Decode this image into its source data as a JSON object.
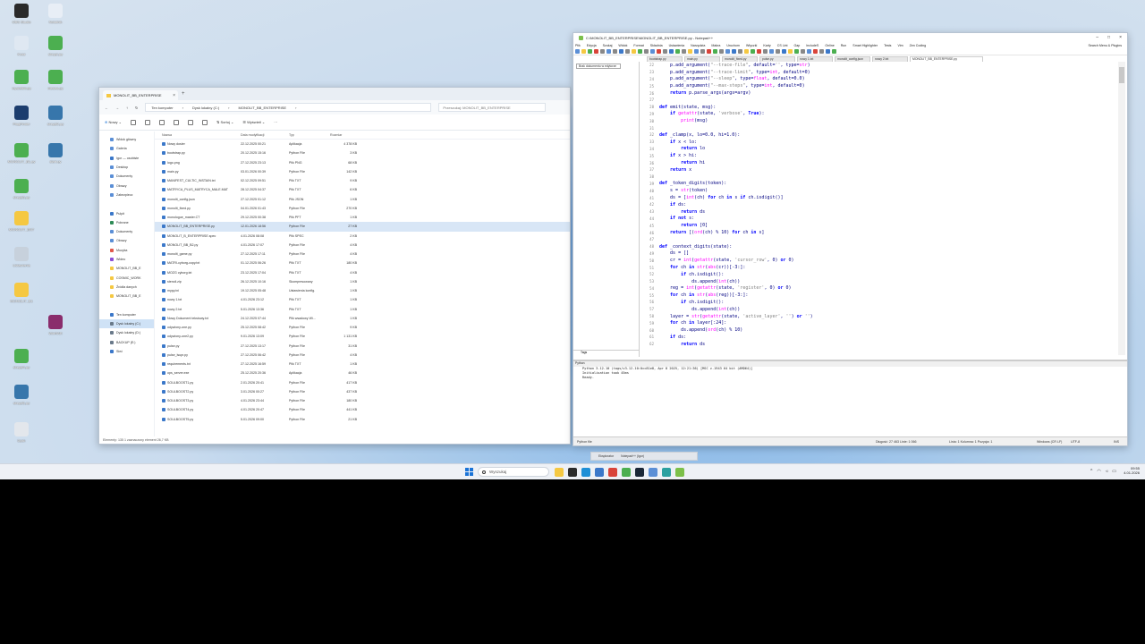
{
  "desktop": {
    "icons": [
      {
        "label": "OBS Studio",
        "color": "#2a2a2a"
      },
      {
        "label": "Notatnik",
        "color": "#e8eef6"
      },
      {
        "label": "Kosz",
        "color": "#dfe8f2"
      },
      {
        "label": "skrypt.py",
        "color": "#4caf50"
      },
      {
        "label": "mycielski.py",
        "color": "#4caf50"
      },
      {
        "label": "meseo.py",
        "color": "#4caf50"
      },
      {
        "label": "FlagFinder",
        "color": "#1c3d6e"
      },
      {
        "label": "skrypt2.py",
        "color": "#3776ab"
      },
      {
        "label": "MONOLIT_B1.py",
        "color": "#4caf50"
      },
      {
        "label": "start.py",
        "color": "#3776ab"
      },
      {
        "label": "skrypt3.py",
        "color": "#4caf50"
      },
      {
        "label": "MONOLIT_ENT",
        "color": "#f5c842"
      },
      {
        "label": "Ustawienia",
        "color": "#c7d1dc"
      },
      {
        "label": "MONOLIT_B1",
        "color": "#f5c842"
      },
      {
        "label": "WinRAR",
        "color": "#8a2d6c"
      },
      {
        "label": "skrypt4.py",
        "color": "#4caf50"
      },
      {
        "label": "skrypt5.py",
        "color": "#3776ab"
      },
      {
        "label": "Dysk",
        "color": "#e3e7ec"
      }
    ]
  },
  "explorer": {
    "tab_title": "MONOLIT_BB_ENTERPRISE",
    "crumbs": [
      "Ten komputer",
      "Dysk lokalny (C:)",
      "MONOLIT_BB_ENTERPRISE"
    ],
    "search_placeholder": "Przeszukaj: MONOLIT_BB_ENTERPRISE",
    "toolbar_new": "Nowy",
    "toolbar_sort": "Sortuj",
    "toolbar_view": "Wyświetl",
    "nav": [
      {
        "label": "Widok główny",
        "color": "#5b8fd6"
      },
      {
        "label": "Galeria",
        "color": "#5b8fd6"
      },
      {
        "label": "Igor — osobiste",
        "color": "#3b78c9"
      },
      {
        "label": "Desktop",
        "color": "#5b8fd6"
      },
      {
        "label": "Dokumenty",
        "color": "#5b8fd6"
      },
      {
        "label": "Obrazy",
        "color": "#5b8fd6"
      },
      {
        "label": "Zabezpiecz",
        "color": "#5b8fd6"
      },
      {
        "label": "",
        "color": "transparent"
      },
      {
        "label": "Pulpit",
        "color": "#3b78c9"
      },
      {
        "label": "Pobrane",
        "color": "#2e8b57"
      },
      {
        "label": "Dokumenty",
        "color": "#5b8fd6"
      },
      {
        "label": "Obrazy",
        "color": "#5b8fd6"
      },
      {
        "label": "Muzyka",
        "color": "#e0584b"
      },
      {
        "label": "Wideo",
        "color": "#8a4fd6"
      },
      {
        "label": "MONOLIT_BB_E",
        "color": "#f5c842"
      },
      {
        "label": "COSMIC_WORK",
        "color": "#f5c842"
      },
      {
        "label": "Źródła danych",
        "color": "#f5c842"
      },
      {
        "label": "MONOLIT_BB_E",
        "color": "#f5c842"
      },
      {
        "label": "",
        "color": "transparent"
      },
      {
        "label": "Ten komputer",
        "color": "#3b78c9"
      },
      {
        "label": "Dysk lokalny (C:)",
        "color": "#6a7a8a"
      },
      {
        "label": "Dysk lokalny (D:)",
        "color": "#6a7a8a"
      },
      {
        "label": "BACKUP (E:)",
        "color": "#6a7a8a"
      },
      {
        "label": "Sieć",
        "color": "#3b78c9"
      }
    ],
    "columns": [
      "Nazwa",
      "Data modyfikacji",
      "Typ",
      "Rozmiar"
    ],
    "files": [
      {
        "name": "Nowy dosier",
        "date": "22.12.2025 00:21",
        "type": "Aplikacja",
        "size": "4 378 KB"
      },
      {
        "name": "bootstrap.py",
        "date": "20.12.2025 15:16",
        "type": "Python File",
        "size": "3 KB"
      },
      {
        "name": "logo.png",
        "date": "27.12.2025 23:13",
        "type": "Plik PNG",
        "size": "68 KB"
      },
      {
        "name": "main.py",
        "date": "03.01.2026 00:39",
        "type": "Python File",
        "size": "142 KB"
      },
      {
        "name": "MANIFEST_CULTIC_INSTAIN.txt",
        "date": "02.12.2025 09:51",
        "type": "Plik TXT",
        "size": "9 KB"
      },
      {
        "name": "MATRYCA_PLUS_MATRYCA_MALE.MAT",
        "date": "28.12.2025 04:37",
        "type": "Plik TXT",
        "size": "6 KB"
      },
      {
        "name": "monolit_config.json",
        "date": "27.12.2025 01:12",
        "type": "Plik JSON",
        "size": "1 KB"
      },
      {
        "name": "monolit_fixed.py",
        "date": "04.01.2026 01:43",
        "type": "Python File",
        "size": "270 KB"
      },
      {
        "name": "monologue_master.CT",
        "date": "29.12.2025 00:38",
        "type": "Plik PFT",
        "size": "1 KB"
      },
      {
        "name": "MONOLIT_BB_ENTERPRISE.py",
        "date": "12.01.2026 18:56",
        "type": "Python File",
        "size": "27 KB"
      },
      {
        "name": "MONOLIT_B_ENTERPRISE.spec",
        "date": "4.01.2026 08:08",
        "type": "Plik SPEC",
        "size": "2 KB"
      },
      {
        "name": "MONOLIT_BB_B2.py",
        "date": "4.01.2026 17:07",
        "type": "Python File",
        "size": "4 KB"
      },
      {
        "name": "monolit_game.py",
        "date": "27.12.2025 17:11",
        "type": "Python File",
        "size": "4 KB"
      },
      {
        "name": "MATRI-cyborg-copy.txt",
        "date": "01.12.2025 06:26",
        "type": "Plik TXT",
        "size": "180 KB"
      },
      {
        "name": "MOZG cyborg.txt",
        "date": "23.12.2025 17:04",
        "type": "Plik TXT",
        "size": "4 KB"
      },
      {
        "name": "stencil.zip",
        "date": "26.12.2025 10:16",
        "type": "Skompresowany",
        "size": "1 KB"
      },
      {
        "name": "mypy.ini",
        "date": "19.12.2025 05:48",
        "type": "Ustawienia konfig.",
        "size": "1 KB"
      },
      {
        "name": "nowy 1.txt",
        "date": "4.01.2026 23:12",
        "type": "Plik TXT",
        "size": "1 KB"
      },
      {
        "name": "nowy 2.txt",
        "date": "5.01.2026 13:36",
        "type": "Plik TXT",
        "size": "1 KB"
      },
      {
        "name": "Nowy Dokument tekstowy.txt",
        "date": "24.12.2025 07:44",
        "type": "Plik wsadowy Wi...",
        "size": "1 KB"
      },
      {
        "name": "odywiony-one.py",
        "date": "25.12.2025 08:42",
        "type": "Python File",
        "size": "9 KB"
      },
      {
        "name": "odywiony-one2.py",
        "date": "9.01.2026 13:09",
        "type": "Python File",
        "size": "1 131 KB"
      },
      {
        "name": "pulse.py",
        "date": "27.12.2025 13:17",
        "type": "Python File",
        "size": "31 KB"
      },
      {
        "name": "pulse_lsupr.py",
        "date": "27.12.2025 06:42",
        "type": "Python File",
        "size": "4 KB"
      },
      {
        "name": "requirements.txt",
        "date": "27.12.2025 16:59",
        "type": "Plik TXT",
        "size": "1 KB"
      },
      {
        "name": "ops_server.exe",
        "date": "25.12.2025 20:36",
        "type": "Aplikacja",
        "size": "46 KB"
      },
      {
        "name": "SOULBOOST1.py",
        "date": "2.01.2026 20:41",
        "type": "Python File",
        "size": "417 KB"
      },
      {
        "name": "SOULBOOST2.py",
        "date": "3.01.2026 00:27",
        "type": "Python File",
        "size": "437 KB"
      },
      {
        "name": "SOULBOOST3.py",
        "date": "4.01.2026 23:44",
        "type": "Python File",
        "size": "180 KB"
      },
      {
        "name": "SOULBOOST4.py",
        "date": "4.01.2026 20:47",
        "type": "Python File",
        "size": "441 KB"
      },
      {
        "name": "SOULBOOST5.py",
        "date": "5.01.2026 09:00",
        "type": "Python File",
        "size": "21 KB"
      }
    ],
    "status": "Elementy: 135    1 zaznaczony element  26,7 KB"
  },
  "npp": {
    "title": "C:\\MONOLIT_BB_ENTERPRISE\\MONOLIT_BB_ENTERPRISE.py - Notepad++",
    "menu": [
      "Plik",
      "Edycja",
      "Szukaj",
      "Widok",
      "Format",
      "Składnia",
      "Ustawienia",
      "Narzędzia",
      "Makra",
      "Uruchom",
      "Wtyczki",
      "Karty",
      "CS Lint",
      "Gap",
      "IncludeS",
      "Online",
      "Run",
      "Smart Highlighter",
      "Tests",
      "Vim",
      "Zen Coding"
    ],
    "search_hint": "Search Menu & Plugins",
    "tabs": [
      "bootstrap.py",
      "main.py",
      "monolit_fixed.py",
      "pulse.py",
      "nowy 1.txt",
      "monolit_config.json",
      "nowy 2.txt",
      "MONOLIT_BB_ENTERPRISE.py"
    ],
    "left_panel_label": "Brak dokumentu w edytorze",
    "left_footer": "Tags",
    "code_lines": [
      {
        "n": "22",
        "t": "    p.add_argument(\"--trace-file\", default='', type=str)"
      },
      {
        "n": "23",
        "t": "    p.add_argument(\"--trace-limit\", type=int, default=0)"
      },
      {
        "n": "24",
        "t": "    p.add_argument(\"--sleep\", type=float, default=0.0)"
      },
      {
        "n": "25",
        "t": "    p.add_argument(\"--max-steps\", type=int, default=0)"
      },
      {
        "n": "26",
        "t": "    return p.parse_args(args=argv)"
      },
      {
        "n": "27",
        "t": ""
      },
      {
        "n": "28",
        "t": "def emit(state, msg):"
      },
      {
        "n": "29",
        "t": "    if getattr(state, 'verbose', True):"
      },
      {
        "n": "30",
        "t": "        print(msg)"
      },
      {
        "n": "31",
        "t": ""
      },
      {
        "n": "32",
        "t": "def _clamp(x, lo=0.0, hi=1.0):"
      },
      {
        "n": "33",
        "t": "    if x < lo:"
      },
      {
        "n": "34",
        "t": "        return lo"
      },
      {
        "n": "35",
        "t": "    if x > hi:"
      },
      {
        "n": "36",
        "t": "        return hi"
      },
      {
        "n": "37",
        "t": "    return x"
      },
      {
        "n": "38",
        "t": ""
      },
      {
        "n": "39",
        "t": "def _token_digits(token):"
      },
      {
        "n": "40",
        "t": "    s = str(token)"
      },
      {
        "n": "41",
        "t": "    ds = [int(ch) for ch in s if ch.isdigit()]"
      },
      {
        "n": "42",
        "t": "    if ds:"
      },
      {
        "n": "43",
        "t": "        return ds"
      },
      {
        "n": "44",
        "t": "    if not s:"
      },
      {
        "n": "45",
        "t": "        return [0]"
      },
      {
        "n": "46",
        "t": "    return [(ord(ch) % 10) for ch in s]"
      },
      {
        "n": "47",
        "t": ""
      },
      {
        "n": "48",
        "t": "def _context_digits(state):"
      },
      {
        "n": "49",
        "t": "    ds = []"
      },
      {
        "n": "50",
        "t": "    cr = int(getattr(state, 'cursor_row', 0) or 0)"
      },
      {
        "n": "51",
        "t": "    for ch in str(abs(cr))[-3:]:"
      },
      {
        "n": "52",
        "t": "        if ch.isdigit():"
      },
      {
        "n": "53",
        "t": "            ds.append(int(ch))"
      },
      {
        "n": "54",
        "t": "    reg = int(getattr(state, 'register', 0) or 0)"
      },
      {
        "n": "55",
        "t": "    for ch in str(abs(reg))[-3:]:"
      },
      {
        "n": "56",
        "t": "        if ch.isdigit():"
      },
      {
        "n": "57",
        "t": "            ds.append(int(ch))"
      },
      {
        "n": "58",
        "t": "    layer = str(getattr(state, 'active_layer', '') or '')"
      },
      {
        "n": "59",
        "t": "    for ch in layer[:24]:"
      },
      {
        "n": "60",
        "t": "        ds.append(ord(ch) % 10)"
      },
      {
        "n": "61",
        "t": "    if ds:"
      },
      {
        "n": "62",
        "t": "        return ds"
      }
    ],
    "console_title": "Python",
    "console_lines": [
      "Python 3.12.10 (tags/v3.12.10:0cc81e8, Apr  8 2025, 12:21:36) [MSC v.1943 64 bit (AMD64)]",
      "Initialisation took 45ms",
      "Ready."
    ],
    "status_lang": "Python file",
    "status_len": "Długość: 27 463    Linie: 1 066",
    "status_pos": "Linia: 1    Kolumna: 1    Pozycja: 1",
    "status_eol": "Windows (CR LF)",
    "status_enc": "UTF-8",
    "status_ins": "INS"
  },
  "taskbar": {
    "search_placeholder": "Wyszukaj",
    "apps": [
      {
        "name": "explorer",
        "color": "#f5c842"
      },
      {
        "name": "terminal",
        "color": "#2b2b2b"
      },
      {
        "name": "edge",
        "color": "#1f8fd6"
      },
      {
        "name": "store",
        "color": "#3b78c9"
      },
      {
        "name": "chrome",
        "color": "#d9443a"
      },
      {
        "name": "chrome-dev",
        "color": "#4caf50"
      },
      {
        "name": "steam",
        "color": "#1b2838"
      },
      {
        "name": "app-blue",
        "color": "#5b8fd6"
      },
      {
        "name": "app-teal",
        "color": "#2ba0a0"
      },
      {
        "name": "notepadpp",
        "color": "#7cc04a"
      }
    ],
    "popup_items": [
      "Eksplorator",
      "Notepad++ (Igor)"
    ],
    "time": "09:55",
    "date": "4.01.2026"
  }
}
